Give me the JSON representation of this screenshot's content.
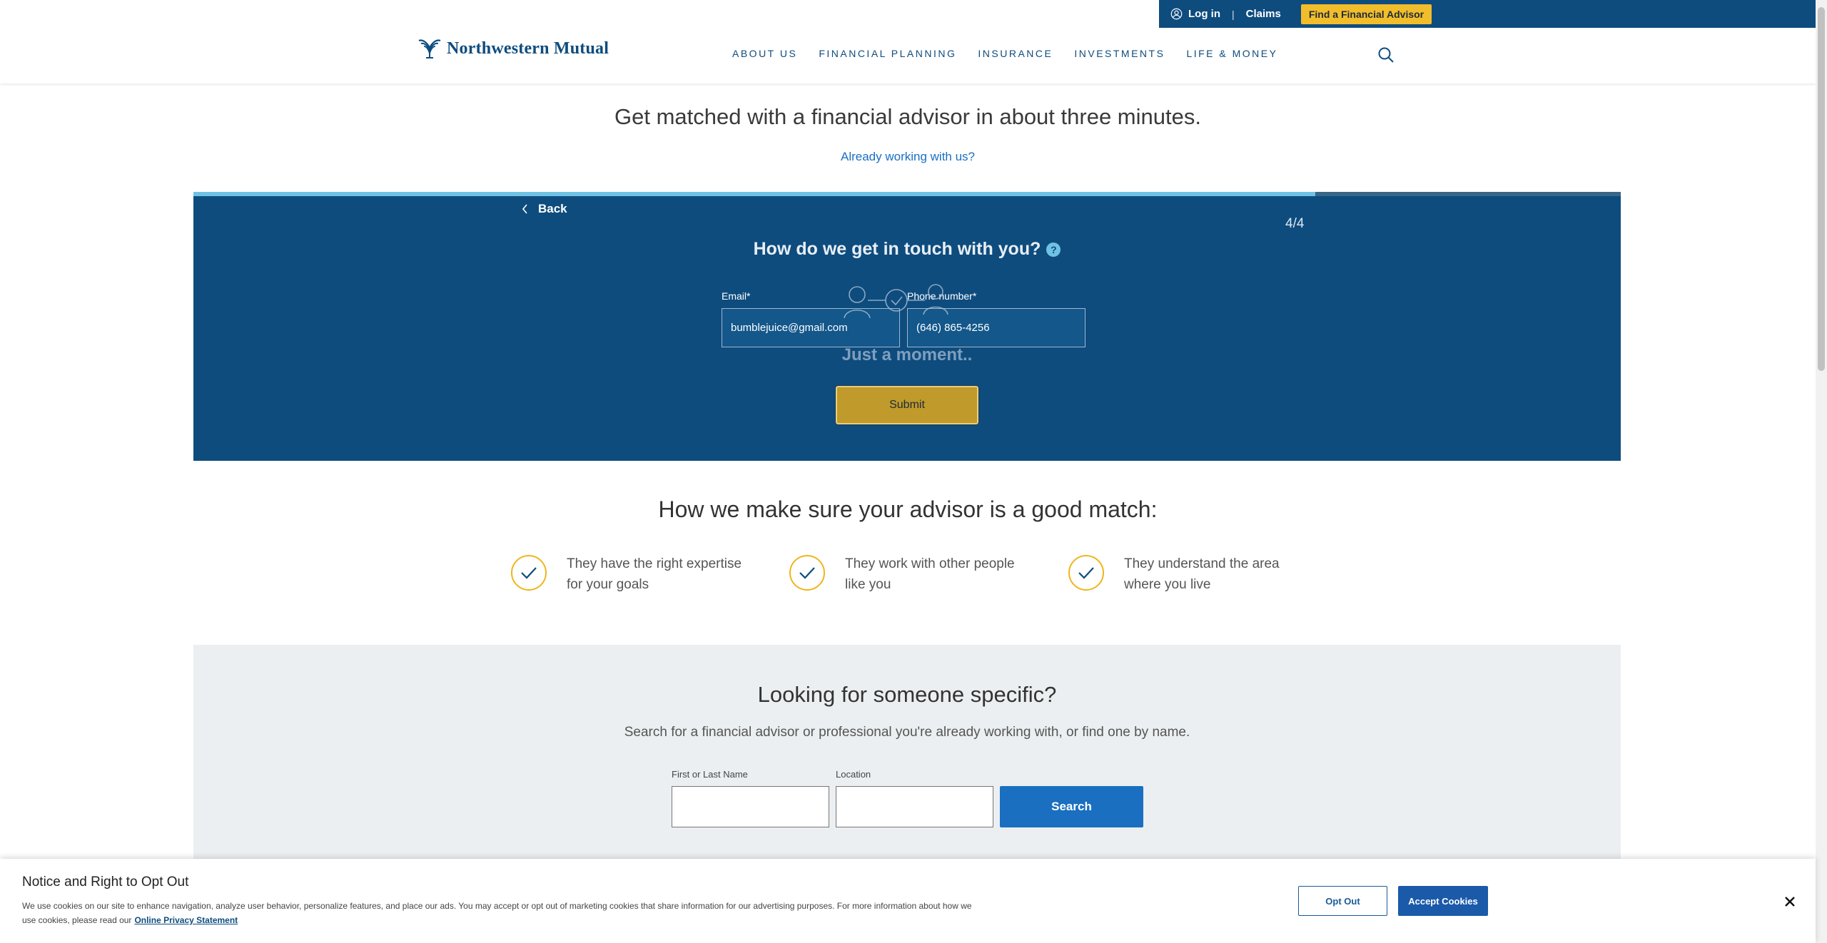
{
  "utility_bar": {
    "login_label": "Log in",
    "separator": "|",
    "claims_label": "Claims",
    "cta_label": "Find a Financial Advisor"
  },
  "header": {
    "logo_text": "Northwestern Mutual",
    "nav": [
      "ABOUT US",
      "FINANCIAL PLANNING",
      "INSURANCE",
      "INVESTMENTS",
      "LIFE & MONEY"
    ]
  },
  "hero": {
    "headline": "Get matched with a financial advisor in about three minutes.",
    "already_link": "Already working with us?"
  },
  "form": {
    "back_label": "Back",
    "step": "4/4",
    "progress": 0.786,
    "question": "How do we get in touch with you?",
    "help_glyph": "?",
    "email_label": "Email*",
    "email_value": "bumblejuice@gmail.com",
    "phone_label": "Phone number*",
    "phone_value": "(646) 865-4256",
    "loading_text": "Just a moment..",
    "submit_label": "Submit"
  },
  "match": {
    "title": "How we make sure your advisor is a good match:",
    "benefits": [
      {
        "line1": "They have the right expertise",
        "line2": "for your goals"
      },
      {
        "line1": "They work with other people",
        "line2": "like you"
      },
      {
        "line1": "They understand the area",
        "line2": "where you live"
      }
    ]
  },
  "specific": {
    "title": "Looking for someone specific?",
    "subtitle": "Search for a financial advisor or professional you're already working with, or find one by name.",
    "name_label": "First or Last Name",
    "location_label": "Location",
    "search_label": "Search"
  },
  "cookie": {
    "title": "Notice and Right to Opt Out",
    "text": "We use cookies on our site to enhance navigation, analyze user behavior, personalize features, and place our ads. You may accept or opt out of marketing cookies that share information for our advertising purposes. For more information about how we use cookies, please read our",
    "link": "Online Privacy Statement",
    "optout_label": "Opt Out",
    "accept_label": "Accept Cookies"
  },
  "colors": {
    "brand_blue": "#0e4c7e",
    "accent_gold": "#f2bd2a",
    "link_blue": "#1a6fc0",
    "progress_fill": "#6fc2e3"
  },
  "icons": [
    "user-icon",
    "logo-icon",
    "search-icon",
    "chevron-left-icon",
    "help-icon",
    "check-icon",
    "close-icon"
  ]
}
